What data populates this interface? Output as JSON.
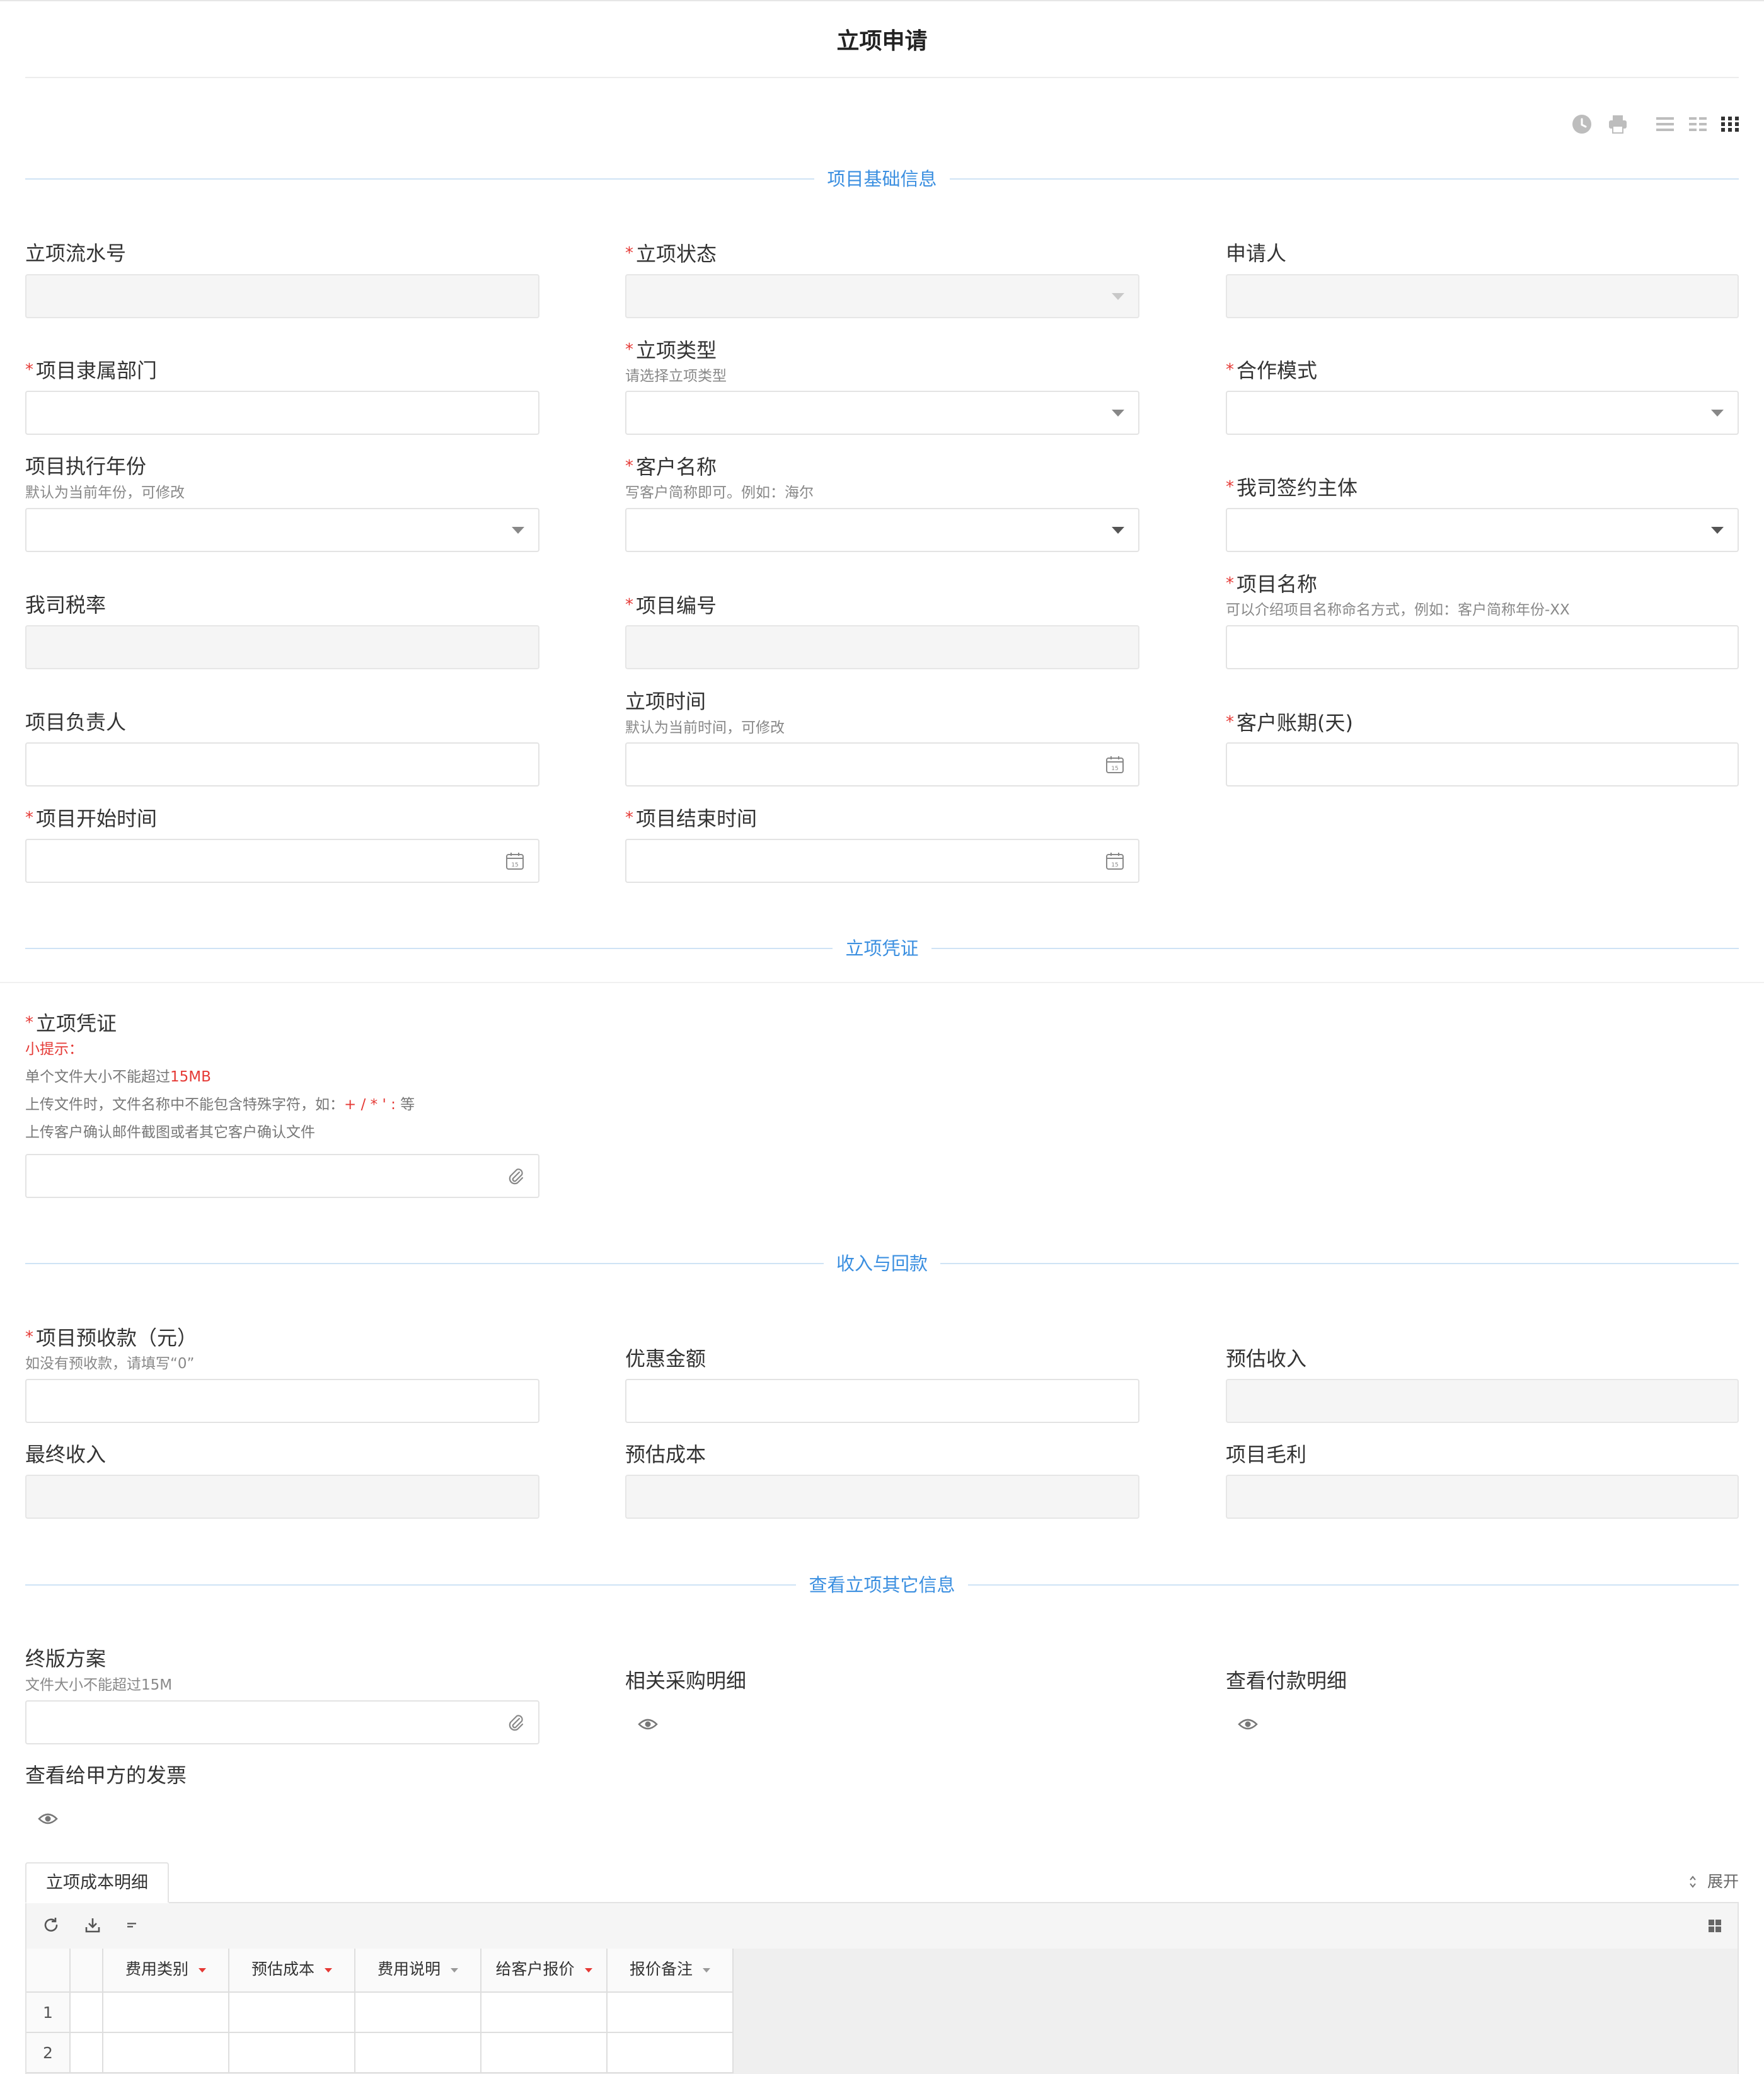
{
  "page": {
    "title": "立项申请"
  },
  "toolbar_icons": [
    "clock-icon",
    "print-icon",
    "layout-one-column-icon",
    "layout-two-column-icon",
    "layout-three-column-icon"
  ],
  "sections": {
    "basic": "项目基础信息",
    "voucher": "立项凭证",
    "income": "收入与回款",
    "other": "查看立项其它信息"
  },
  "fields": {
    "serial_no": {
      "label": "立项流水号"
    },
    "status": {
      "label": "立项状态",
      "required": true
    },
    "applicant": {
      "label": "申请人"
    },
    "dept": {
      "label": "项目隶属部门",
      "required": true
    },
    "type": {
      "label": "立项类型",
      "required": true,
      "hint": "请选择立项类型"
    },
    "coop_mode": {
      "label": "合作模式",
      "required": true
    },
    "exec_year": {
      "label": "项目执行年份",
      "hint": "默认为当前年份，可修改"
    },
    "customer": {
      "label": "客户名称",
      "required": true,
      "hint": "写客户简称即可。例如：海尔"
    },
    "entity": {
      "label": "我司签约主体",
      "required": true
    },
    "tax_rate": {
      "label": "我司税率"
    },
    "proj_no": {
      "label": "项目编号",
      "required": true
    },
    "proj_name": {
      "label": "项目名称",
      "required": true,
      "hint": "可以介绍项目名称命名方式，例如：客户简称年份-XX"
    },
    "manager": {
      "label": "项目负责人"
    },
    "created_time": {
      "label": "立项时间",
      "hint": "默认为当前时间，可修改"
    },
    "account_period": {
      "label": "客户账期(天)",
      "required": true
    },
    "start_time": {
      "label": "项目开始时间",
      "required": true
    },
    "end_time": {
      "label": "项目结束时间",
      "required": true
    },
    "voucher": {
      "label": "立项凭证",
      "required": true,
      "tip_title": "小提示：",
      "tip1_prefix": "单个文件大小不能超过",
      "tip1_highlight": "15MB",
      "tip2_prefix": "上传文件时，文件名称中不能包含特殊字符，如：",
      "tip2_highlight": "+ / * ' :",
      "tip2_suffix": " 等",
      "tip3": "上传客户确认邮件截图或者其它客户确认文件"
    },
    "prepay": {
      "label": "项目预收款（元）",
      "required": true,
      "hint": "如没有预收款，请填写“0”"
    },
    "discount": {
      "label": "优惠金额"
    },
    "est_income": {
      "label": "预估收入"
    },
    "final_income": {
      "label": "最终收入"
    },
    "est_cost": {
      "label": "预估成本"
    },
    "gross_profit": {
      "label": "项目毛利"
    },
    "final_plan": {
      "label": "终版方案",
      "hint": "文件大小不能超过15M"
    },
    "purchase_detail": {
      "label": "相关采购明细"
    },
    "payment_detail": {
      "label": "查看付款明细"
    },
    "invoice": {
      "label": "查看给甲方的发票"
    }
  },
  "cost_table": {
    "tab_label": "立项成本明细",
    "expand_label": "展开",
    "columns": [
      "费用类别",
      "预估成本",
      "费用说明",
      "给客户报价",
      "报价备注"
    ],
    "rows": [
      "1",
      "2"
    ]
  }
}
